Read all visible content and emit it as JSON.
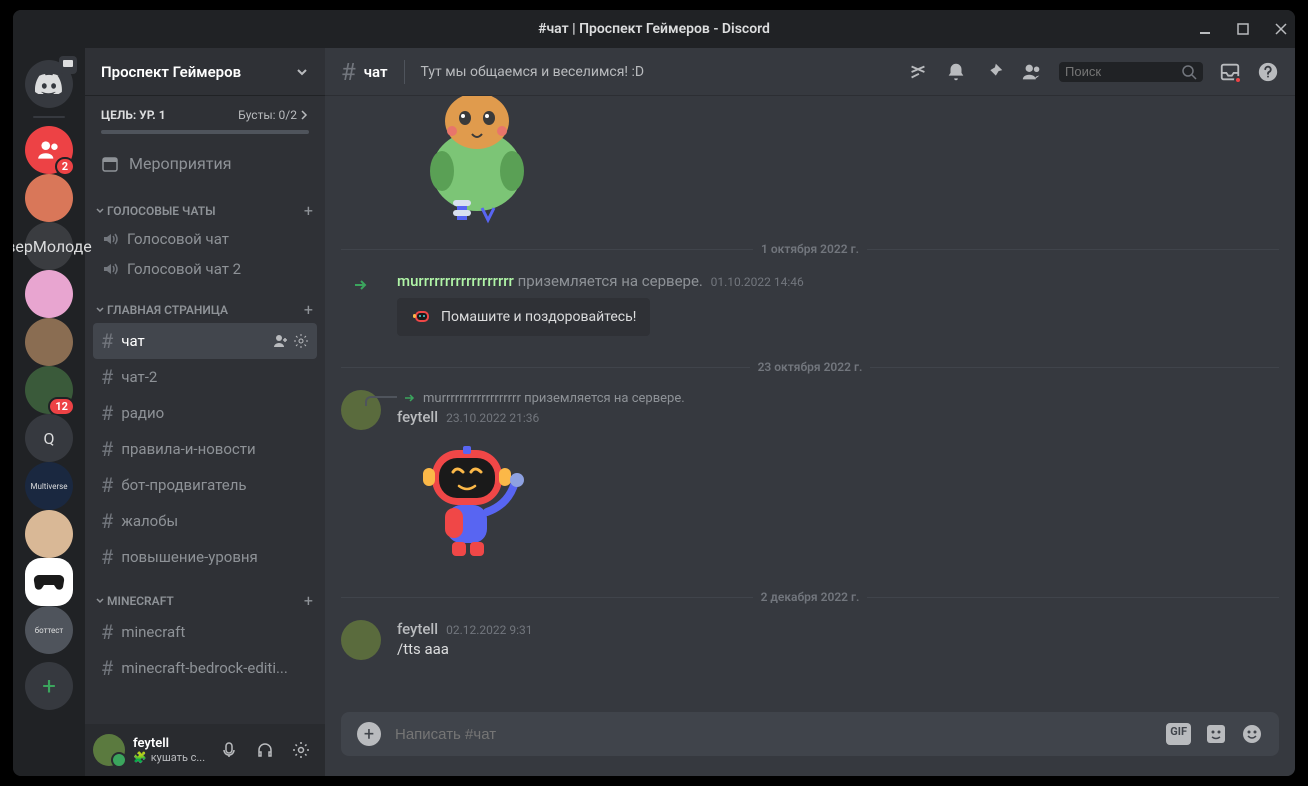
{
  "window": {
    "title": "#чат | Проспект Геймеров - Discord"
  },
  "server_list": {
    "home_badge": "",
    "items": [
      {
        "color": "#ed4245",
        "badge": "2",
        "kind": "friends"
      },
      {
        "color": "#d97759",
        "label": ""
      },
      {
        "color": "#3a3c40",
        "label": "верМолоде",
        "text": true
      },
      {
        "color": "#e8a5d0",
        "label": ""
      },
      {
        "color": "#8a6d52",
        "label": ""
      },
      {
        "color": "#3a5a3a",
        "badge": "12",
        "label": ""
      },
      {
        "color": "#36393f",
        "label": "Q",
        "text": true
      },
      {
        "color": "#1a2840",
        "label": "Multiverse",
        "text": true,
        "small": true
      },
      {
        "color": "#d9b896",
        "label": ""
      },
      {
        "color": "#ffffff",
        "label": "",
        "kind": "controller",
        "selected": true
      },
      {
        "color": "#4f545c",
        "label": "боттест",
        "text": true,
        "small": true
      }
    ]
  },
  "server_header": {
    "name": "Проспект Геймеров"
  },
  "boost": {
    "goal_label": "ЦЕЛЬ: УР. 1",
    "count_label": "Бусты: 0/2"
  },
  "events": {
    "label": "Мероприятия"
  },
  "categories": [
    {
      "name": "ГОЛОСОВЫЕ ЧАТЫ",
      "kind": "voice",
      "channels": [
        {
          "name": "Голосовой чат"
        },
        {
          "name": "Голосовой чат 2"
        }
      ]
    },
    {
      "name": "ГЛАВНАЯ СТРАНИЦА",
      "kind": "text",
      "channels": [
        {
          "name": "чат",
          "active": true
        },
        {
          "name": "чат-2"
        },
        {
          "name": "радио"
        },
        {
          "name": "правила-и-новости"
        },
        {
          "name": "бот-продвигатель"
        },
        {
          "name": "жалобы"
        },
        {
          "name": "повышение-уровня"
        }
      ]
    },
    {
      "name": "MINECRAFT",
      "kind": "text",
      "channels": [
        {
          "name": "minecraft"
        },
        {
          "name": "minecraft-bedrock-editi..."
        }
      ]
    }
  ],
  "user_panel": {
    "name": "feytell",
    "status_emoji": "🧩",
    "status": "кушать с..."
  },
  "main_header": {
    "channel": "чат",
    "topic": "Тут мы общаемся и веселимся! :D",
    "search_placeholder": "Поиск"
  },
  "messages": {
    "divider1": "1 октября 2022 г.",
    "join": {
      "user": "murrrrrrrrrrrrrrrrrr",
      "text": "приземляется на сервере.",
      "time": "01.10.2022 14:46",
      "wave": "Помашите и поздоровайтесь!"
    },
    "divider2": "23 октября 2022 г.",
    "reply_ref": "murrrrrrrrrrrrrrrrrr приземляется на сервере.",
    "msg1": {
      "author": "feytell",
      "time": "23.10.2022 21:36"
    },
    "divider3": "2 декабря 2022 г.",
    "msg2": {
      "author": "feytell",
      "time": "02.12.2022 9:31",
      "text": "/tts aaa"
    }
  },
  "input": {
    "placeholder": "Написать #чат",
    "gif": "GIF"
  }
}
